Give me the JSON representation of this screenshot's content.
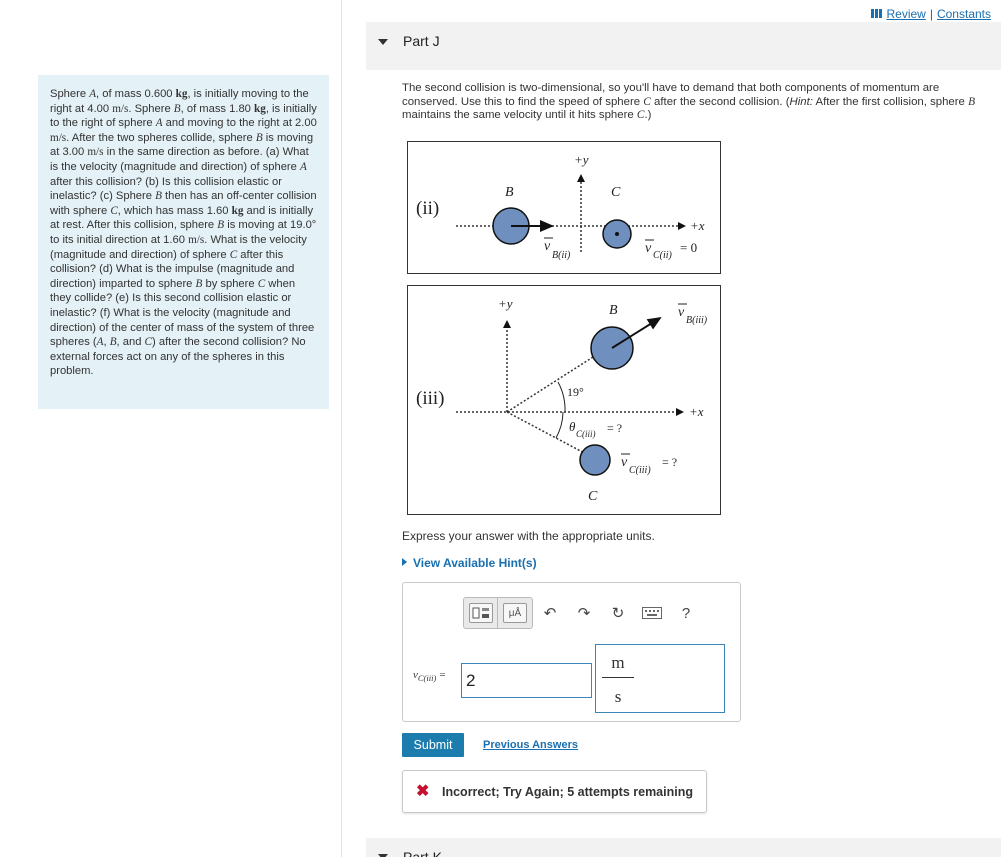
{
  "header": {
    "review_label": "Review",
    "separator": "|",
    "constants_label": "Constants"
  },
  "problem": {
    "text_html": "Sphere <span class='v'>A</span>, of mass 0.600 <b class='fs'>kg</b>, is initially moving to the right at 4.00 <span class='fs'>m/s</span>. Sphere <span class='v'>B</span>, of mass 1.80 <b class='fs'>kg</b>, is initially to the right of sphere <span class='v'>A</span> and moving to the right at 2.00 <span class='fs'>m/s</span>. After the two spheres collide, sphere <span class='v'>B</span> is moving at 3.00 <span class='fs'>m/s</span> in the same direction as before. (a) What is the velocity (magnitude and direction) of sphere <span class='v'>A</span> after this collision? (b) Is this collision elastic or inelastic? (c) Sphere <span class='v'>B</span> then has an off-center collision with sphere <span class='v'>C</span>, which has mass 1.60 <b class='fs'>kg</b> and is initially at rest. After this collision, sphere <span class='v'>B</span> is moving at 19.0° to its initial direction at 1.60 <span class='fs'>m/s</span>. What is the velocity (magnitude and direction) of sphere <span class='v'>C</span> after this collision? (d) What is the impulse (magnitude and direction) imparted to sphere <span class='v'>B</span> by sphere <span class='v'>C</span> when they collide? (e) Is this second collision elastic or inelastic? (f) What is the velocity (magnitude and direction) of the center of mass of the system of three spheres (<span class='v'>A</span>, <span class='v'>B</span>, and <span class='v'>C</span>) after the second collision? No external forces act on any of the spheres in this problem."
  },
  "part": {
    "title": "Part J",
    "intro_html": "The second collision is two-dimensional, so you'll have to demand that both components of momentum are conserved. Use this to find the speed of sphere <span class='v'>C</span> after the second collision. (<i>Hint:</i> After the first collision, sphere <span class='v'>B</span> maintains the same velocity until it hits sphere <span class='v'>C</span>.)",
    "next_title": "Part K"
  },
  "figure_ii": {
    "panel": "(ii)",
    "y_label": "+y",
    "x_label": "+x",
    "sphere_b": "B",
    "sphere_c": "C",
    "vel_b": "B(ii)",
    "vel_c": "C(ii)",
    "vel_c_value": "= 0"
  },
  "figure_iii": {
    "panel": "(iii)",
    "y_label": "+y",
    "x_label": "+x",
    "sphere_b": "B",
    "sphere_c": "C",
    "angle": "19°",
    "theta_sub": "C(iii)",
    "theta_value": "= ?",
    "vel_b": "B(iii)",
    "vel_c": "C(iii)",
    "vel_c_value": "= ?"
  },
  "answer": {
    "express": "Express your answer with the appropriate units.",
    "hints": "View Available Hint(s)",
    "var_main": "v",
    "var_sub": "C(iii)",
    "equals": "=",
    "value": "2",
    "unit_num": "m",
    "unit_den": "s",
    "units_tool": "μÅ",
    "help": "?"
  },
  "actions": {
    "submit": "Submit",
    "previous": "Previous Answers"
  },
  "feedback": {
    "icon": "✖",
    "message": "Incorrect; Try Again; 5 attempts remaining"
  },
  "colors": {
    "accent": "#1c7cae",
    "link": "#1a6fb0",
    "sphere_fill": "#6f8fbf",
    "problem_bg": "#e4f1f6",
    "error": "#c8102e"
  }
}
